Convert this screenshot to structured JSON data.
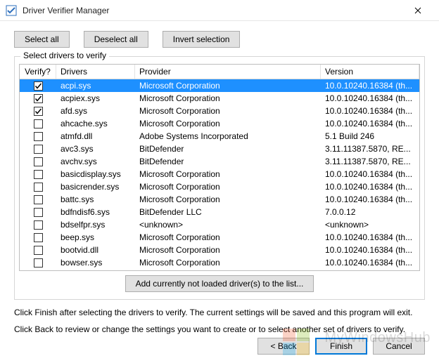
{
  "window": {
    "title": "Driver Verifier Manager"
  },
  "toolbar": {
    "select_all": "Select all",
    "deselect_all": "Deselect all",
    "invert_selection": "Invert selection"
  },
  "groupbox": {
    "legend": "Select drivers to verify"
  },
  "columns": {
    "verify": "Verify?",
    "drivers": "Drivers",
    "provider": "Provider",
    "version": "Version"
  },
  "drivers": [
    {
      "checked": true,
      "selected": true,
      "name": "acpi.sys",
      "provider": "Microsoft Corporation",
      "version": "10.0.10240.16384 (th..."
    },
    {
      "checked": true,
      "selected": false,
      "name": "acpiex.sys",
      "provider": "Microsoft Corporation",
      "version": "10.0.10240.16384 (th..."
    },
    {
      "checked": true,
      "selected": false,
      "name": "afd.sys",
      "provider": "Microsoft Corporation",
      "version": "10.0.10240.16384 (th..."
    },
    {
      "checked": false,
      "selected": false,
      "name": "ahcache.sys",
      "provider": "Microsoft Corporation",
      "version": "10.0.10240.16384 (th..."
    },
    {
      "checked": false,
      "selected": false,
      "name": "atmfd.dll",
      "provider": "Adobe Systems Incorporated",
      "version": "5.1 Build 246"
    },
    {
      "checked": false,
      "selected": false,
      "name": "avc3.sys",
      "provider": "BitDefender",
      "version": "3.11.11387.5870, RE..."
    },
    {
      "checked": false,
      "selected": false,
      "name": "avchv.sys",
      "provider": "BitDefender",
      "version": "3.11.11387.5870, RE..."
    },
    {
      "checked": false,
      "selected": false,
      "name": "basicdisplay.sys",
      "provider": "Microsoft Corporation",
      "version": "10.0.10240.16384 (th..."
    },
    {
      "checked": false,
      "selected": false,
      "name": "basicrender.sys",
      "provider": "Microsoft Corporation",
      "version": "10.0.10240.16384 (th..."
    },
    {
      "checked": false,
      "selected": false,
      "name": "battc.sys",
      "provider": "Microsoft Corporation",
      "version": "10.0.10240.16384 (th..."
    },
    {
      "checked": false,
      "selected": false,
      "name": "bdfndisf6.sys",
      "provider": "BitDefender LLC",
      "version": "7.0.0.12"
    },
    {
      "checked": false,
      "selected": false,
      "name": "bdselfpr.sys",
      "provider": "<unknown>",
      "version": "<unknown>"
    },
    {
      "checked": false,
      "selected": false,
      "name": "beep.sys",
      "provider": "Microsoft Corporation",
      "version": "10.0.10240.16384 (th..."
    },
    {
      "checked": false,
      "selected": false,
      "name": "bootvid.dll",
      "provider": "Microsoft Corporation",
      "version": "10.0.10240.16384 (th..."
    },
    {
      "checked": false,
      "selected": false,
      "name": "bowser.sys",
      "provider": "Microsoft Corporation",
      "version": "10.0.10240.16384 (th..."
    }
  ],
  "add_button": "Add currently not loaded driver(s) to the list...",
  "instructions": {
    "line1": "Click Finish after selecting the drivers to verify. The current settings will be saved and this program will exit.",
    "line2": "Click Back to review or change the settings you want to create or to select another set of drivers to verify."
  },
  "footer": {
    "back": "< Back",
    "finish": "Finish",
    "cancel": "Cancel"
  },
  "watermark": "MyWindowsHub"
}
